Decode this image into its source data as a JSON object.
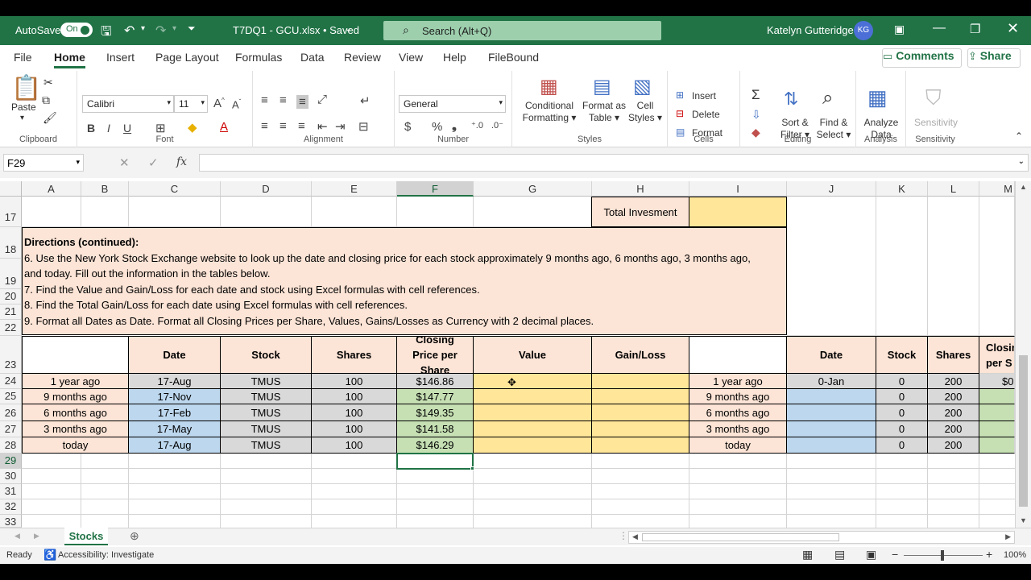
{
  "titlebar": {
    "autosave": "AutoSave",
    "toggle": "On",
    "filename": "T7DQ1 - GCU.xlsx • Saved",
    "search": "Search (Alt+Q)",
    "user": "Katelyn Gutteridge",
    "initials": "KG"
  },
  "menu": {
    "tabs": [
      "File",
      "Home",
      "Insert",
      "Page Layout",
      "Formulas",
      "Data",
      "Review",
      "View",
      "Help",
      "FileBound"
    ],
    "comments": "Comments",
    "share": "Share"
  },
  "ribbon": {
    "clipboard": {
      "paste": "Paste",
      "label": "Clipboard"
    },
    "font": {
      "name": "Calibri",
      "size": "11",
      "label": "Font",
      "bold": "B",
      "italic": "I",
      "underline": "U"
    },
    "alignment": {
      "label": "Alignment"
    },
    "number": {
      "format": "General",
      "label": "Number"
    },
    "styles": {
      "cond1": "Conditional",
      "cond2": "Formatting",
      "fmt1": "Format as",
      "fmt2": "Table",
      "cell1": "Cell",
      "cell2": "Styles",
      "label": "Styles"
    },
    "cells": {
      "insert": "Insert",
      "delete": "Delete",
      "format": "Format",
      "label": "Cells"
    },
    "editing": {
      "sort1": "Sort &",
      "sort2": "Filter",
      "find1": "Find &",
      "find2": "Select",
      "label": "Editing"
    },
    "analysis": {
      "a1": "Analyze",
      "a2": "Data",
      "label": "Analysis"
    },
    "sensitivity": {
      "s1": "Sensitivity",
      "label": "Sensitivity"
    }
  },
  "formula_bar": {
    "namebox": "F29",
    "fx": "fx",
    "formula": ""
  },
  "columns": [
    "A",
    "B",
    "C",
    "D",
    "E",
    "F",
    "G",
    "H",
    "I",
    "J",
    "K",
    "L",
    "M"
  ],
  "row_numbers": [
    "17",
    "18",
    "19",
    "20",
    "21",
    "22",
    "23",
    "24",
    "25",
    "26",
    "27",
    "28",
    "29",
    "30",
    "31",
    "32",
    "33"
  ],
  "total_investment_label": "Total Invesment",
  "directions": [
    "Directions (continued):",
    "6. Use the New York Stock Exchange website to look up the date and closing price for each stock approximately 9 months ago, 6 months ago, 3 months ago,",
    "and today. Fill out the information in the tables below.",
    "7. Find the Value and Gain/Loss for each date and stock using Excel formulas with cell references.",
    "8. Find the Total Gain/Loss for each date using Excel formulas with cell references.",
    "9. Format all Dates as Date. Format all Closing Prices per Share, Values, Gains/Losses as Currency with 2 decimal places."
  ],
  "table1": {
    "headers": [
      "Date",
      "Stock",
      "Shares",
      "Closing Price per Share",
      "Value",
      "Gain/Loss"
    ],
    "rows": [
      {
        "period": "1 year ago",
        "date": "17-Aug",
        "stock": "TMUS",
        "shares": "100",
        "price": "$146.86"
      },
      {
        "period": "9 months ago",
        "date": "17-Nov",
        "stock": "TMUS",
        "shares": "100",
        "price": "$147.77"
      },
      {
        "period": "6 months ago",
        "date": "17-Feb",
        "stock": "TMUS",
        "shares": "100",
        "price": "$149.35"
      },
      {
        "period": "3 months ago",
        "date": "17-May",
        "stock": "TMUS",
        "shares": "100",
        "price": "$141.58"
      },
      {
        "period": "today",
        "date": "17-Aug",
        "stock": "TMUS",
        "shares": "100",
        "price": "$146.29"
      }
    ]
  },
  "table2": {
    "headers": [
      "Date",
      "Stock",
      "Shares",
      "Closin",
      "per S"
    ],
    "rows": [
      {
        "period": "1 year ago",
        "date": "0-Jan",
        "stock": "0",
        "shares": "200",
        "price": "$0"
      },
      {
        "period": "9 months ago",
        "date": "",
        "stock": "0",
        "shares": "200",
        "price": ""
      },
      {
        "period": "6 months ago",
        "date": "",
        "stock": "0",
        "shares": "200",
        "price": ""
      },
      {
        "period": "3 months ago",
        "date": "",
        "stock": "0",
        "shares": "200",
        "price": ""
      },
      {
        "period": "today",
        "date": "",
        "stock": "0",
        "shares": "200",
        "price": ""
      }
    ]
  },
  "sheet_tab": "Stocks",
  "status": {
    "ready": "Ready",
    "accessibility": "Accessibility: Investigate",
    "zoom": "100%"
  }
}
